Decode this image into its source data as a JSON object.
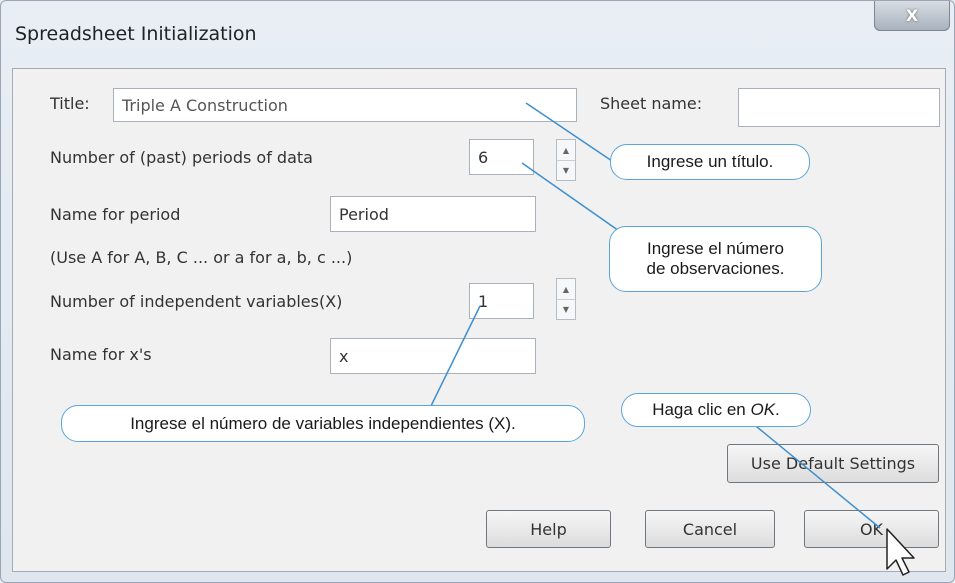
{
  "window": {
    "title": "Spreadsheet Initialization",
    "close_label": "X"
  },
  "form": {
    "title_label": "Title:",
    "title_value": "Triple A Construction",
    "sheet_name_label": "Sheet name:",
    "sheet_name_value": "",
    "periods_label": "Number of (past) periods of data",
    "periods_value": "6",
    "period_name_label": "Name for period",
    "period_name_value": "Period",
    "hint": "(Use A for A, B, C ... or a for a, b, c ...)",
    "indep_label": "Number of independent variables(X)",
    "indep_value": "1",
    "x_name_label": "Name for x's",
    "x_name_value": "x"
  },
  "buttons": {
    "default": "Use Default Settings",
    "help": "Help",
    "cancel": "Cancel",
    "ok": "OK"
  },
  "callouts": {
    "title": "Ingrese un título.",
    "obs_line1": "Ingrese el número",
    "obs_line2": "de observaciones.",
    "vars": "Ingrese el número de variables independientes (X).",
    "ok_prefix": "Haga clic en ",
    "ok_em": "OK",
    "ok_suffix": "."
  },
  "colors": {
    "callout_border": "#5aa5d6",
    "leader_line": "#3d8fd0"
  },
  "icons": [
    "close-icon",
    "spin-up-icon",
    "spin-down-icon",
    "mouse-cursor-icon"
  ]
}
